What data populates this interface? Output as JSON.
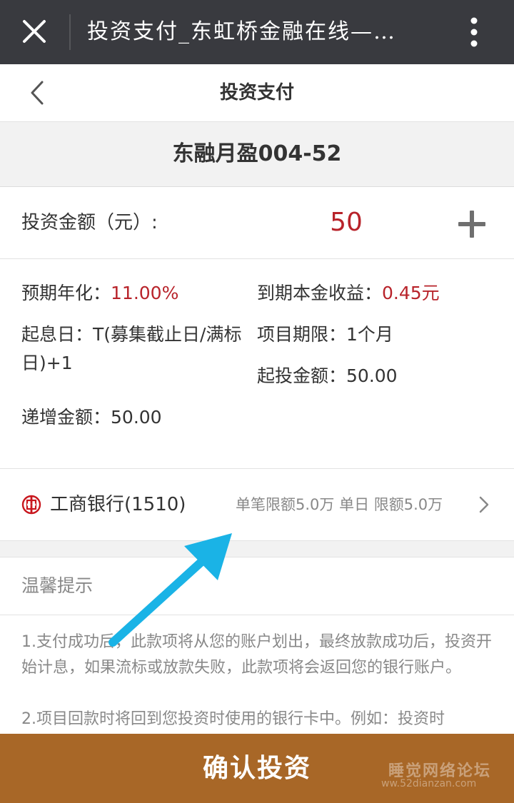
{
  "window": {
    "title": "投资支付_东虹桥金融在线—…"
  },
  "header": {
    "title": "投资支付"
  },
  "product": {
    "name": "东融月盈004-52"
  },
  "amount": {
    "label": "投资金额（元）:",
    "value": "50"
  },
  "details": {
    "annual_label": "预期年化：",
    "annual_value": "11.00%",
    "profit_label": "到期本金收益：",
    "profit_value": "0.45元",
    "start_label": "起息日：",
    "start_value": "T(募集截止日/满标日)+1",
    "term_label": "项目期限：",
    "term_value": "1个月",
    "min_label": "起投金额：",
    "min_value": "50.00",
    "step_label": "递增金额：",
    "step_value": "50.00"
  },
  "bank": {
    "name": "工商银行(1510)",
    "limit": "单笔限额5.0万 单日 限额5.0万",
    "icon": "icbc-logo-icon",
    "color": "#c8161d"
  },
  "tips": {
    "title": "温馨提示",
    "tip1": "1.支付成功后，此款项将从您的账户划出，最终放款成功后，投资开始计息，如果流标或放款失败，此款项将会返回您的银行账户。",
    "tip2": "2.项目回款时将回到您投资时使用的银行卡中。例如：投资时"
  },
  "confirm": {
    "label": "确认投资"
  },
  "watermark": {
    "line1": "睡觉网络论坛",
    "line2": "ww.52dianzan.com"
  },
  "colors": {
    "accent": "#a86727",
    "highlight": "#b8232a",
    "arrow": "#1ab3e6"
  }
}
